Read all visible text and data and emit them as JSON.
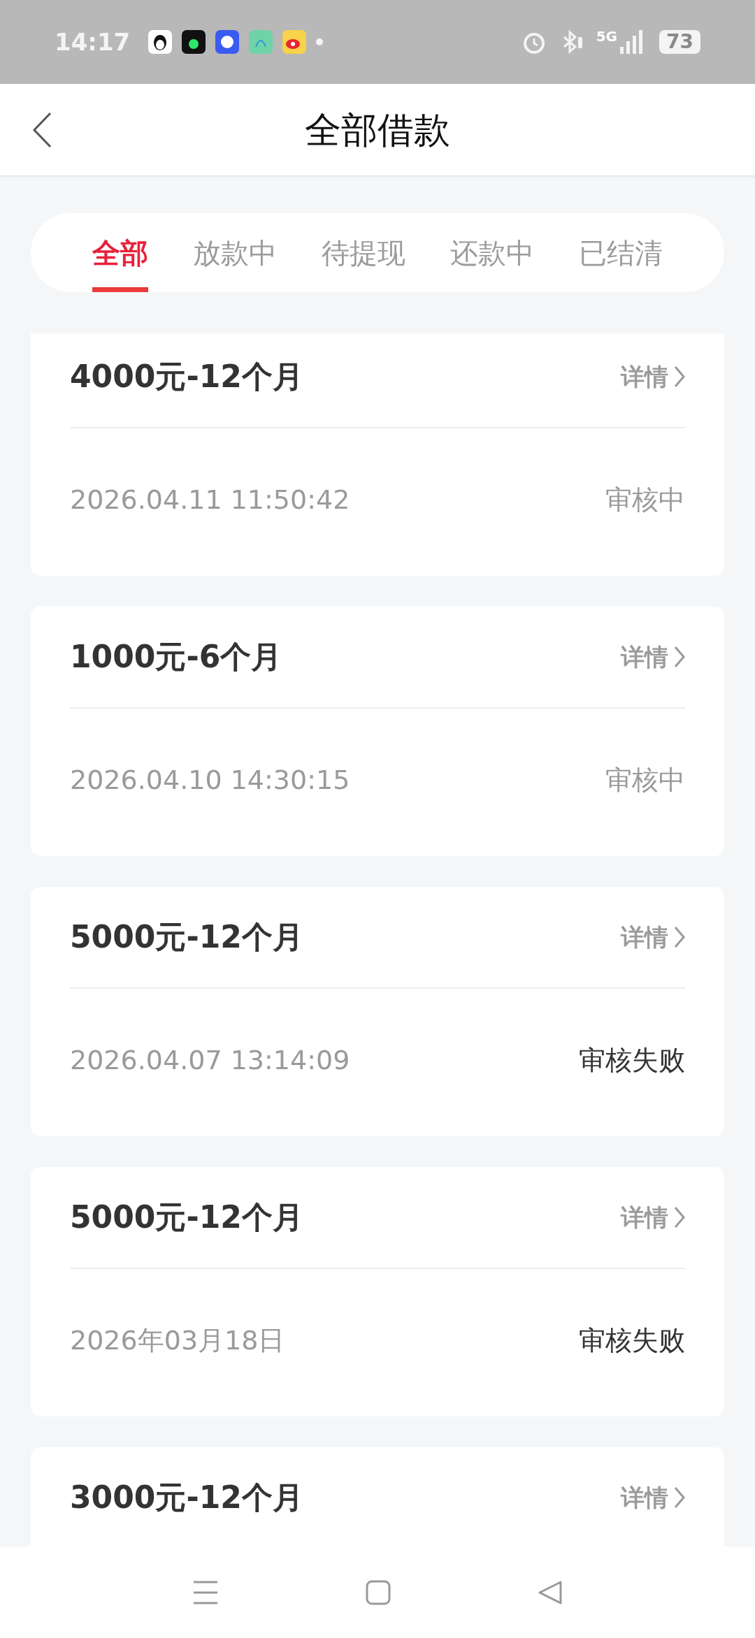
{
  "status_bar": {
    "time": "14:17",
    "network": "5G",
    "battery": "73"
  },
  "header": {
    "title": "全部借款"
  },
  "tabs": [
    {
      "label": "全部",
      "selected": true
    },
    {
      "label": "放款中",
      "selected": false
    },
    {
      "label": "待提现",
      "selected": false
    },
    {
      "label": "还款中",
      "selected": false
    },
    {
      "label": "已结清",
      "selected": false
    }
  ],
  "loans": [
    {
      "title": "4000元-12个月",
      "detail": "详情",
      "date": "2026.04.11 11:50:42",
      "status": "审核中",
      "kind": "pending"
    },
    {
      "title": "1000元-6个月",
      "detail": "详情",
      "date": "2026.04.10 14:30:15",
      "status": "审核中",
      "kind": "pending"
    },
    {
      "title": "5000元-12个月",
      "detail": "详情",
      "date": "2026.04.07 13:14:09",
      "status": "审核失败",
      "kind": "failed"
    },
    {
      "title": "5000元-12个月",
      "detail": "详情",
      "date": "2026年03月18日",
      "status": "审核失败",
      "kind": "failed"
    },
    {
      "title": "3000元-12个月",
      "detail": "详情"
    }
  ]
}
